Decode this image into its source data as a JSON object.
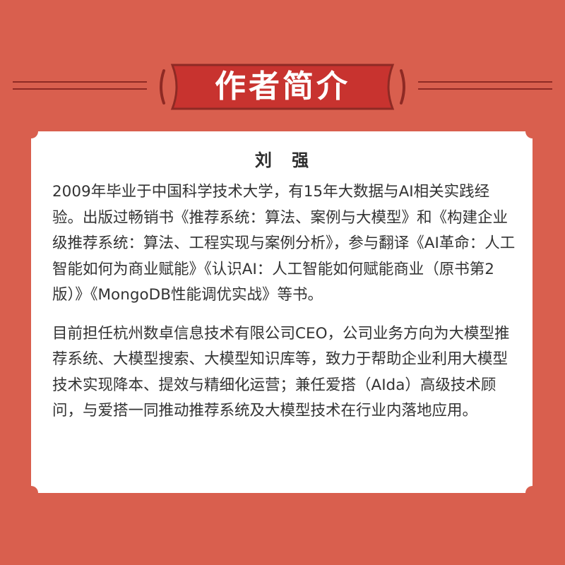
{
  "header": {
    "title": "作者简介"
  },
  "author": {
    "name": "刘 强"
  },
  "bio": {
    "paragraphs": [
      "2009年毕业于中国科学技术大学，有15年大数据与AI相关实践经验。出版过畅销书《推荐系统：算法、案例与大模型》和《构建企业级推荐系统：算法、工程实现与案例分析》，参与翻译《AI革命：人工智能如何为商业赋能》《认识AI：人工智能如何赋能商业（原书第2版）》《MongoDB性能调优实战》等书。",
      "目前担任杭州数卓信息技术有限公司CEO，公司业务方向为大模型推荐系统、大模型搜索、大模型知识库等，致力于帮助企业利用大模型技术实现降本、提效与精细化运营；兼任爱搭（AIda）高级技术顾问，与爱搭一同推动推荐系统及大模型技术在行业内落地应用。"
    ]
  },
  "colors": {
    "background": "#D95F4E",
    "banner": "#C8332F",
    "banner_outline": "#8E2A24",
    "card": "#FFFFFF",
    "text": "#333333"
  }
}
